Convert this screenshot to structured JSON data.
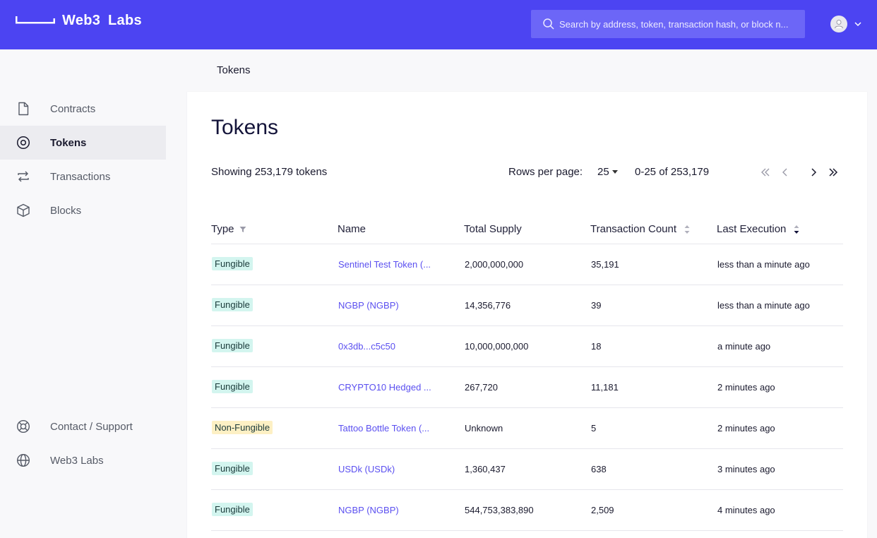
{
  "header": {
    "brand": "Web3  Labs",
    "search_placeholder": "Search by address, token, transaction hash, or block n...",
    "colors": {
      "bar": "#4c44f2",
      "search": "#6c66f7"
    }
  },
  "breadcrumb": "Tokens",
  "sidebar": {
    "items": [
      {
        "label": "Contracts",
        "icon": "document-icon",
        "active": false
      },
      {
        "label": "Tokens",
        "icon": "token-icon",
        "active": true
      },
      {
        "label": "Transactions",
        "icon": "transfer-icon",
        "active": false
      },
      {
        "label": "Blocks",
        "icon": "cube-icon",
        "active": false
      }
    ],
    "bottom": [
      {
        "label": "Contact / Support",
        "icon": "lifebuoy-icon"
      },
      {
        "label": "Web3 Labs",
        "icon": "globe-icon"
      }
    ]
  },
  "main": {
    "title": "Tokens",
    "showing": "Showing 253,179 tokens",
    "rows_per_page_label": "Rows per page:",
    "rows_per_page_value": "25",
    "range": "0-25 of 253,179",
    "columns": [
      "Type",
      "Name",
      "Total Supply",
      "Transaction Count",
      "Last Execution"
    ],
    "rows": [
      {
        "type": "Fungible",
        "name": "Sentinel Test Token (...",
        "supply": "2,000,000,000",
        "count": "35,191",
        "last": "less than a minute ago"
      },
      {
        "type": "Fungible",
        "name": "NGBP (NGBP)",
        "supply": "14,356,776",
        "count": "39",
        "last": "less than a minute ago"
      },
      {
        "type": "Fungible",
        "name": "0x3db...c5c50",
        "supply": "10,000,000,000",
        "count": "18",
        "last": "a minute ago"
      },
      {
        "type": "Fungible",
        "name": "CRYPTO10 Hedged ...",
        "supply": "267,720",
        "count": "11,181",
        "last": "2 minutes ago"
      },
      {
        "type": "Non-Fungible",
        "name": "Tattoo Bottle Token (...",
        "supply": "Unknown",
        "count": "5",
        "last": "2 minutes ago"
      },
      {
        "type": "Fungible",
        "name": "USDk (USDk)",
        "supply": "1,360,437",
        "count": "638",
        "last": "3 minutes ago"
      },
      {
        "type": "Fungible",
        "name": "NGBP (NGBP)",
        "supply": "544,753,383,890",
        "count": "2,509",
        "last": "4 minutes ago"
      }
    ],
    "badge_colors": {
      "Fungible": "#d3f5ef",
      "Non-Fungible": "#fdf0c4"
    },
    "link_color": "#5a4ff0"
  }
}
